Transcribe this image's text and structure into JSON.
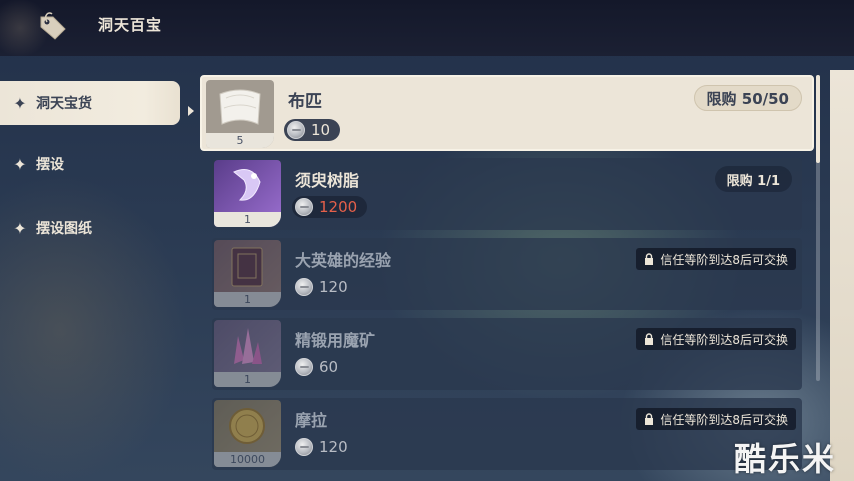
{
  "header": {
    "title": "洞天百宝",
    "icon": "tag-icon"
  },
  "sidebar": {
    "items": [
      {
        "label": "洞天宝货",
        "icon": "star-icon",
        "active": true
      },
      {
        "label": "摆设",
        "icon": "star-icon",
        "active": false
      },
      {
        "label": "摆设图纸",
        "icon": "star-icon",
        "active": false
      }
    ]
  },
  "items": [
    {
      "name": "布匹",
      "quantity": "5",
      "price": "10",
      "limit": "限购 50/50",
      "selected": true
    },
    {
      "name": "须臾树脂",
      "quantity": "1",
      "price": "1200",
      "limit": "限购 1/1",
      "price_color": "#e5604a"
    },
    {
      "name": "大英雄的经验",
      "quantity": "1",
      "price": "120",
      "lock_note": "信任等阶到达8后可交换"
    },
    {
      "name": "精锻用魔矿",
      "quantity": "1",
      "price": "60",
      "lock_note": "信任等阶到达8后可交换"
    },
    {
      "name": "摩拉",
      "quantity": "10000",
      "price": "120",
      "lock_note": "信任等阶到达8后可交换"
    }
  ],
  "watermark": "酷乐米",
  "colors": {
    "accent_cream": "#ece5d8",
    "dark_text": "#3b4354",
    "price_red": "#e5604a"
  }
}
